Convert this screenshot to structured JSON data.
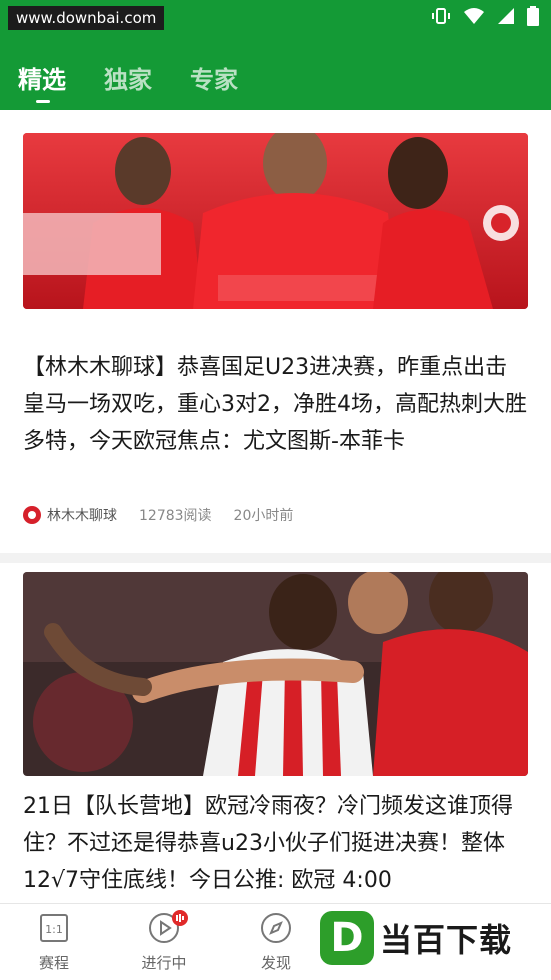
{
  "status_bar": {
    "watermark": "www.downbai.com",
    "icons": [
      "vibrate-icon",
      "wifi-icon",
      "signal-icon",
      "battery-icon"
    ]
  },
  "tabs": [
    {
      "label": "精选",
      "active": true
    },
    {
      "label": "独家",
      "active": false
    },
    {
      "label": "专家",
      "active": false
    }
  ],
  "articles": [
    {
      "image": "benfica-players",
      "title": "【林木木聊球】恭喜国足U23进决赛，昨重点出击皇马一场双吃，重心3对2，净胜4场，高配热刺大胜多特，今天欧冠焦点：尤文图斯-本菲卡",
      "author": "林木木聊球",
      "reads": "12783阅读",
      "time": "20小时前"
    },
    {
      "image": "bilbao-players",
      "title": "21日【队长营地】欧冠冷雨夜？冷门频发这谁顶得住？不过还是得恭喜u23小伙子们挺进决赛！整体12√7守住底线！今日公推: 欧冠 4:00"
    }
  ],
  "bottom_nav": [
    {
      "label": "赛程",
      "icon": "calendar-icon"
    },
    {
      "label": "进行中",
      "icon": "play-icon",
      "badge": "live"
    },
    {
      "label": "发现",
      "icon": "compass-icon"
    }
  ],
  "download_watermark": {
    "logo": "D",
    "text": "当百下载"
  },
  "colors": {
    "brand_green": "#149a36",
    "accent_red": "#e02a2a"
  }
}
